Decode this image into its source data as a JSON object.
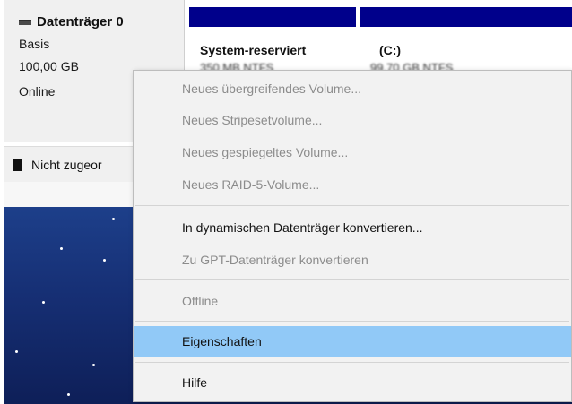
{
  "disk": {
    "name": "Datenträger 0",
    "type": "Basis",
    "size": "100,00 GB",
    "status": "Online"
  },
  "partitions": [
    {
      "label": "System-reserviert",
      "info": "350 MB NTFS"
    },
    {
      "label": "(C:)",
      "info": "99,70 GB NTFS"
    }
  ],
  "unallocated": {
    "label": "Nicht zugeor"
  },
  "context_menu": {
    "items": [
      {
        "label": "Neues übergreifendes Volume...",
        "enabled": false
      },
      {
        "label": "Neues Stripesetvolume...",
        "enabled": false
      },
      {
        "label": "Neues gespiegeltes Volume...",
        "enabled": false
      },
      {
        "label": "Neues RAID-5-Volume...",
        "enabled": false
      },
      {
        "label": "In dynamischen Datenträger konvertieren...",
        "enabled": true
      },
      {
        "label": "Zu GPT-Datenträger konvertieren",
        "enabled": false
      },
      {
        "label": "Offline",
        "enabled": false
      },
      {
        "label": "Eigenschaften",
        "enabled": true,
        "highlighted": true
      },
      {
        "label": "Hilfe",
        "enabled": true
      }
    ]
  },
  "colors": {
    "partition_bar": "#00008b",
    "highlight": "#91c9f7",
    "disabled_text": "#8c8c8c",
    "wallpaper": "#162f74"
  }
}
